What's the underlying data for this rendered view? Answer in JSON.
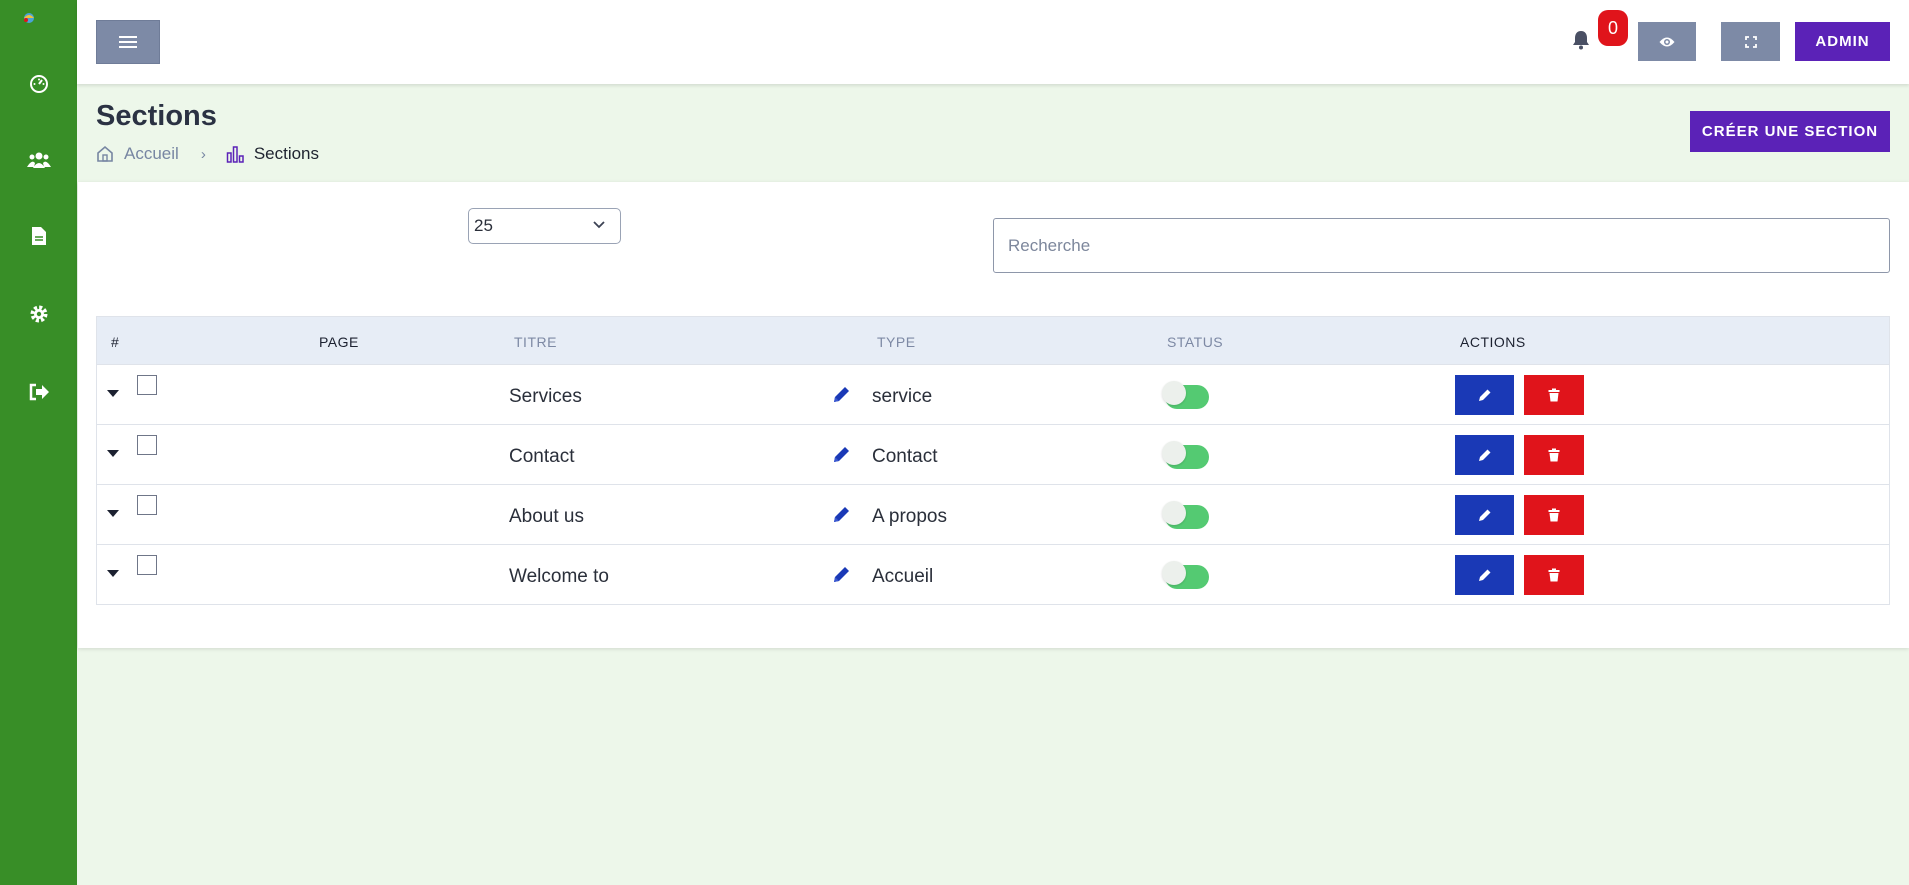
{
  "sidebar": {
    "items": [
      {
        "icon": "dashboard-icon"
      },
      {
        "icon": "users-icon"
      },
      {
        "icon": "document-icon"
      },
      {
        "icon": "gear-icon"
      },
      {
        "icon": "logout-icon"
      }
    ]
  },
  "topbar": {
    "notification_count": "0",
    "admin_label": "ADMIN"
  },
  "header": {
    "title": "Sections",
    "breadcrumb": {
      "home": "Accueil",
      "current": "Sections"
    },
    "create_button": "CRÉER UNE SECTION"
  },
  "controls": {
    "per_page": "25",
    "search_placeholder": "Recherche"
  },
  "table": {
    "columns": [
      "#",
      "PAGE",
      "TITRE",
      "TYPE",
      "STATUS",
      "ACTIONS"
    ],
    "rows": [
      {
        "title": "Services",
        "type": "service",
        "status": true
      },
      {
        "title": "Contact",
        "type": "Contact",
        "status": true
      },
      {
        "title": "About us",
        "type": "A propos",
        "status": true
      },
      {
        "title": "Welcome to",
        "type": "Accueil",
        "status": true
      }
    ]
  },
  "colors": {
    "sidebar": "#388e27",
    "primary": "#5b22b7",
    "edit": "#1a39b6",
    "danger": "#e0141b",
    "toggle_on": "#54ca72",
    "page_background": "#edf7ea"
  }
}
